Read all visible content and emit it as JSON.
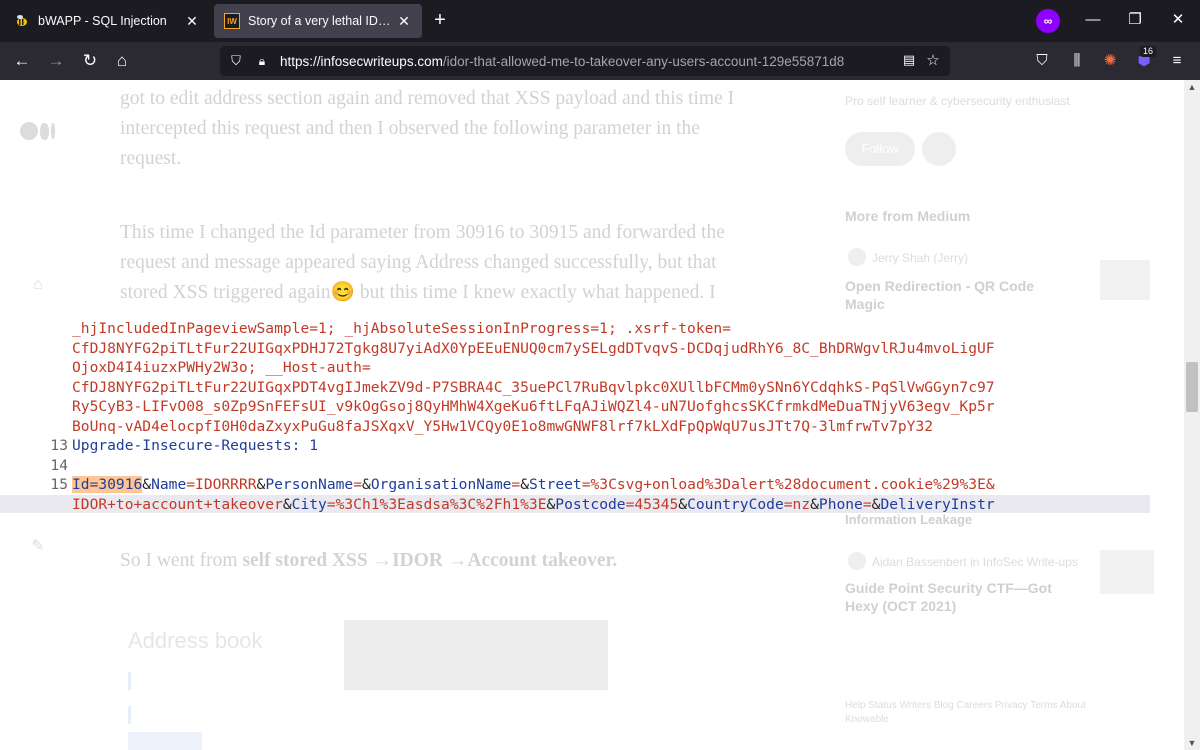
{
  "browser": {
    "tabs": [
      {
        "title": "bWAPP - SQL Injection",
        "favicon": "bee",
        "active": false
      },
      {
        "title": "Story of a very lethal IDOR.. Hel",
        "favicon": "IW",
        "active": true
      }
    ],
    "badge_count": "16",
    "url": {
      "domain": "https://infosecwriteups.com",
      "path": "/idor-that-allowed-me-to-takeover-any-users-account-129e55871d8"
    }
  },
  "article": {
    "para1": [
      "got to edit address section again and removed that XSS payload and this time I",
      "intercepted this request and then I observed the following parameter in the",
      "request."
    ],
    "para2": [
      "This time I changed the Id parameter from 30916 to 30915 and forwarded the",
      "request and message appeared saying Address changed successfully, but that",
      "stored XSS triggered again😊 but this time I knew exactly what happened. I"
    ],
    "summary_prefix": "So I went from ",
    "summary_bold": "self stored XSS →IDOR →Account takeover.",
    "address_book_title": "Address book"
  },
  "sidebar": {
    "bio": "Pro self learner & cybersecurity enthusiast",
    "follow": "Follow",
    "more_from_medium": "More from Medium",
    "post1_author": "Jerry Shah (Jerry)",
    "post1_title_line1": "Open Redirection - QR Code",
    "post1_title_line2": "Magic",
    "post2_fragment": "Information Leakage",
    "post3_author": "Aidan Bassenbert in InfoSec Write-ups",
    "post3_title_line1": "Guide Point Security CTF—Got",
    "post3_title_line2": "Hexy (OCT 2021)",
    "footer_links": "Help  Status  Writers  Blog  Careers  Privacy  Terms  About",
    "footer_links2": "Knowable"
  },
  "code": {
    "line_a": "_hjIncludedInPageviewSample=1; _hjAbsoluteSessionInProgress=1; .xsrf-token=",
    "line_b": "CfDJ8NYFG2piTLtFur22UIGqxPDHJ72Tgkg8U7yiAdX0YpEEuENUQ0cm7ySELgdDTvqvS-DCDqjudRhY6_8C_BhDRWgvlRJu4mvoLigUF",
    "line_c": "OjoxD4I4iuzxPWHy2W3o; __Host-auth=",
    "line_d": "CfDJ8NYFG2piTLtFur22UIGqxPDT4vgIJmekZV9d-P7SBRA4C_35uePCl7RuBqvlpkc0XUllbFCMm0ySNn6YCdqhkS-PqSlVwGGyn7c97",
    "line_e": "Ry5CyB3-LIFvO08_s0Zp9SnFEFsUI_v9kOgGsoj8QyHMhW4XgeKu6ftLFqAJiWQZl4-uN7UofghcsSKCfrmkdMeDuaTNjyV63egv_Kp5r",
    "line_f": "BoUnq-vAD4elocpfI0H0daZxyxPuGu8faJSXqxV_Y5Hw1VCQy0E1o8mwGNWF8lrf7kLXdFpQpWqU7usJTt7Q-3lmfrwTv7pY32",
    "line13_num": "13",
    "line13": "Upgrade-Insecure-Requests: 1",
    "line14_num": "14",
    "line15_num": "15",
    "id_param": "Id=30916",
    "body_rest": [
      {
        "t": "&",
        "c": "amp"
      },
      {
        "t": "Name",
        "c": "key"
      },
      {
        "t": "=IDORRRR",
        "c": "val"
      },
      {
        "t": "&",
        "c": "amp"
      },
      {
        "t": "PersonName",
        "c": "key"
      },
      {
        "t": "=",
        "c": "val"
      },
      {
        "t": "&",
        "c": "amp"
      },
      {
        "t": "OrganisationName",
        "c": "key"
      },
      {
        "t": "=",
        "c": "val"
      },
      {
        "t": "&",
        "c": "amp"
      },
      {
        "t": "Street",
        "c": "key"
      },
      {
        "t": "=%3Csvg+onload%3Dalert%28document.cookie%29%3E&",
        "c": "val"
      }
    ],
    "body_line2": [
      {
        "t": "IDOR+to+account+takeover",
        "c": "val"
      },
      {
        "t": "&",
        "c": "amp"
      },
      {
        "t": "City",
        "c": "key"
      },
      {
        "t": "=%3Ch1%3Easdsa%3C%2Fh1%3E",
        "c": "val"
      },
      {
        "t": "&",
        "c": "amp"
      },
      {
        "t": "Postcode",
        "c": "key"
      },
      {
        "t": "=45345",
        "c": "val"
      },
      {
        "t": "&",
        "c": "amp"
      },
      {
        "t": "CountryCode",
        "c": "key"
      },
      {
        "t": "=nz",
        "c": "val"
      },
      {
        "t": "&",
        "c": "amp"
      },
      {
        "t": "Phone",
        "c": "key"
      },
      {
        "t": "=",
        "c": "val"
      },
      {
        "t": "&",
        "c": "amp"
      },
      {
        "t": "DeliveryInstr",
        "c": "key"
      }
    ]
  }
}
